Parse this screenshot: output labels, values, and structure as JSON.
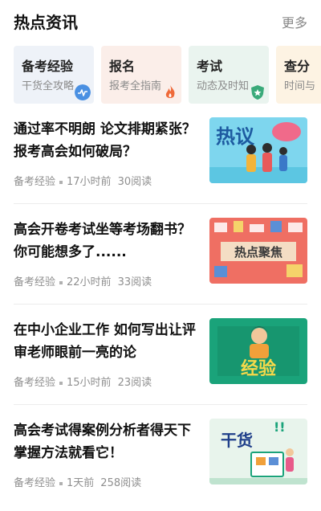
{
  "header": {
    "title": "热点资讯",
    "more": "更多"
  },
  "categories": [
    {
      "title": "备考经验",
      "subtitle": "干货全攻略",
      "bg": "#eef2f8",
      "icon": "pulse-icon",
      "icon_color": "#4a90e2"
    },
    {
      "title": "报名",
      "subtitle": "报考全指南",
      "bg": "#fbeee9",
      "icon": "flame-icon",
      "icon_color": "#ef6a3a"
    },
    {
      "title": "考试",
      "subtitle": "动态及时知",
      "bg": "#eaf4ef",
      "icon": "star-shield-icon",
      "icon_color": "#3aaa7a"
    },
    {
      "title": "查分",
      "subtitle": "时间与",
      "bg": "#fdf3e3",
      "icon": "",
      "icon_color": "#f0a040"
    }
  ],
  "articles": [
    {
      "title": "通过率不明朗 论文排期紧张？报考高会如何破局？",
      "category": "备考经验",
      "time": "17小时前",
      "views": "30阅读",
      "thumb_text": "热议",
      "thumb": "hot-discussion-thumbnail"
    },
    {
      "title": "高会开卷考试坐等考场翻书？你可能想多了......",
      "category": "备考经验",
      "time": "22小时前",
      "views": "33阅读",
      "thumb_text": "热点聚焦",
      "thumb": "hot-focus-thumbnail"
    },
    {
      "title": "在中小企业工作 如何写出让评审老师眼前一亮的论",
      "category": "备考经验",
      "time": "15小时前",
      "views": "23阅读",
      "thumb_text": "经验",
      "thumb": "experience-thumbnail"
    },
    {
      "title": "高会考试得案例分析者得天下 掌握方法就看它！",
      "category": "备考经验",
      "time": "1天前",
      "views": "258阅读",
      "thumb_text": "干货",
      "thumb": "practical-tips-thumbnail"
    }
  ]
}
